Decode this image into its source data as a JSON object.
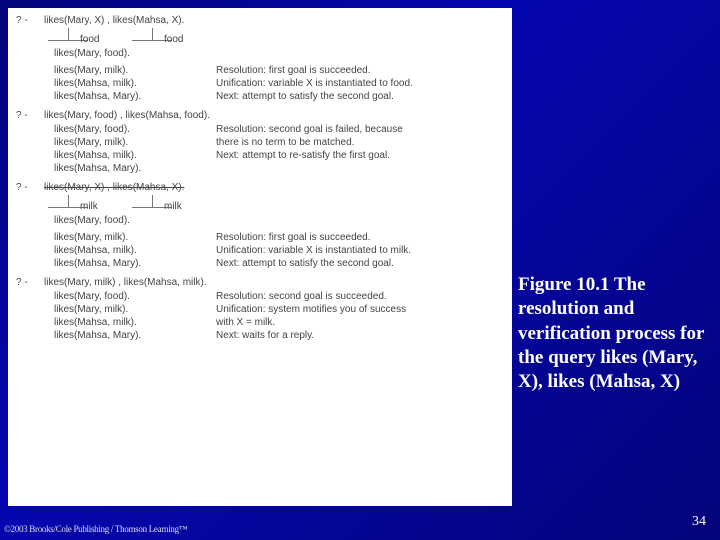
{
  "caption": "Figure 10.1  The resolution and verification process for the query likes (Mary, X), likes (Mahsa,  X)",
  "pagenum": "34",
  "copyright": "©2003 Brooks/Cole Publishing / Thomson Learning™",
  "blocks": [
    {
      "prompt": "? -",
      "query": "likes(Mary, X) , likes(Mahsa, X).",
      "tree": {
        "leftWord": "food",
        "rightWord": "food",
        "leftUnder": "likes(Mary, food)."
      },
      "clauses": [
        "likes(Mary, milk).",
        "likes(Mahsa, milk).",
        "likes(Mahsa, Mary)."
      ],
      "explain": [
        "Resolution: first goal is succeeded.",
        "Unification: variable X is instantiated to food.",
        "Next: attempt to satisfy the second goal."
      ]
    },
    {
      "prompt": "? -",
      "query": "likes(Mary, food) , likes(Mahsa, food).",
      "tree": null,
      "clauses": [
        "likes(Mary, food).",
        "likes(Mary, milk).",
        "likes(Mahsa, milk).",
        "likes(Mahsa, Mary)."
      ],
      "explain": [
        "Resolution: second goal is failed, because",
        "there is no term to be matched.",
        "Next: attempt to re-satisfy the first goal."
      ]
    },
    {
      "prompt": "? -",
      "query": "likes(Mary, X) , likes(Mahsa, X).",
      "queryStrike": true,
      "tree": {
        "leftWord": "milk",
        "rightWord": "milk",
        "leftUnder": "likes(Mary, food)."
      },
      "clauses": [
        "likes(Mary, milk).",
        "likes(Mahsa, milk).",
        "likes(Mahsa, Mary)."
      ],
      "explain": [
        "Resolution: first goal is succeeded.",
        "Unification: variable X is instantiated to milk.",
        "Next: attempt to satisfy the second goal."
      ]
    },
    {
      "prompt": "? -",
      "query": "likes(Mary, milk) , likes(Mahsa, milk).",
      "tree": null,
      "clauses": [
        "likes(Mary, food).",
        "likes(Mary, milk).",
        "likes(Mahsa, milk).",
        "likes(Mahsa, Mary)."
      ],
      "explain": [
        "Resolution: second goal is succeeded.",
        "Unification: system motifies you of success",
        "with X = milk.",
        "Next: waits for a reply."
      ]
    }
  ]
}
